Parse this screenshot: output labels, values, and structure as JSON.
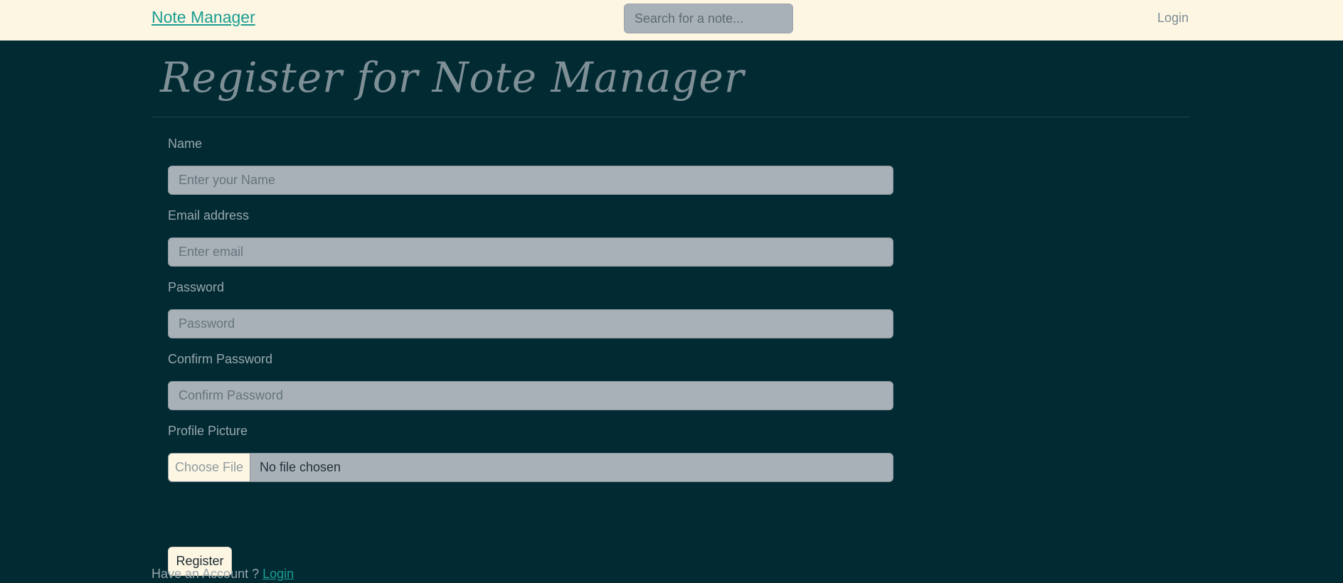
{
  "navbar": {
    "brand": "Note Manager",
    "search_placeholder": "Search for a note...",
    "login_label": "Login"
  },
  "page": {
    "title": "Register for Note Manager"
  },
  "form": {
    "name": {
      "label": "Name",
      "placeholder": "Enter your Name"
    },
    "email": {
      "label": "Email address",
      "placeholder": "Enter email"
    },
    "password": {
      "label": "Password",
      "placeholder": "Password"
    },
    "confirm_password": {
      "label": "Confirm Password",
      "placeholder": "Confirm Password"
    },
    "profile_picture": {
      "label": "Profile Picture",
      "button_label": "Choose File",
      "status": "No file chosen"
    },
    "submit_label": "Register"
  },
  "footer": {
    "prompt": "Have an Account ? ",
    "link_label": "Login"
  },
  "colors": {
    "navbar_bg": "#fdf6e3",
    "page_bg": "#012a33",
    "accent": "#1a9e93",
    "input_bg": "#a9b1b8"
  }
}
